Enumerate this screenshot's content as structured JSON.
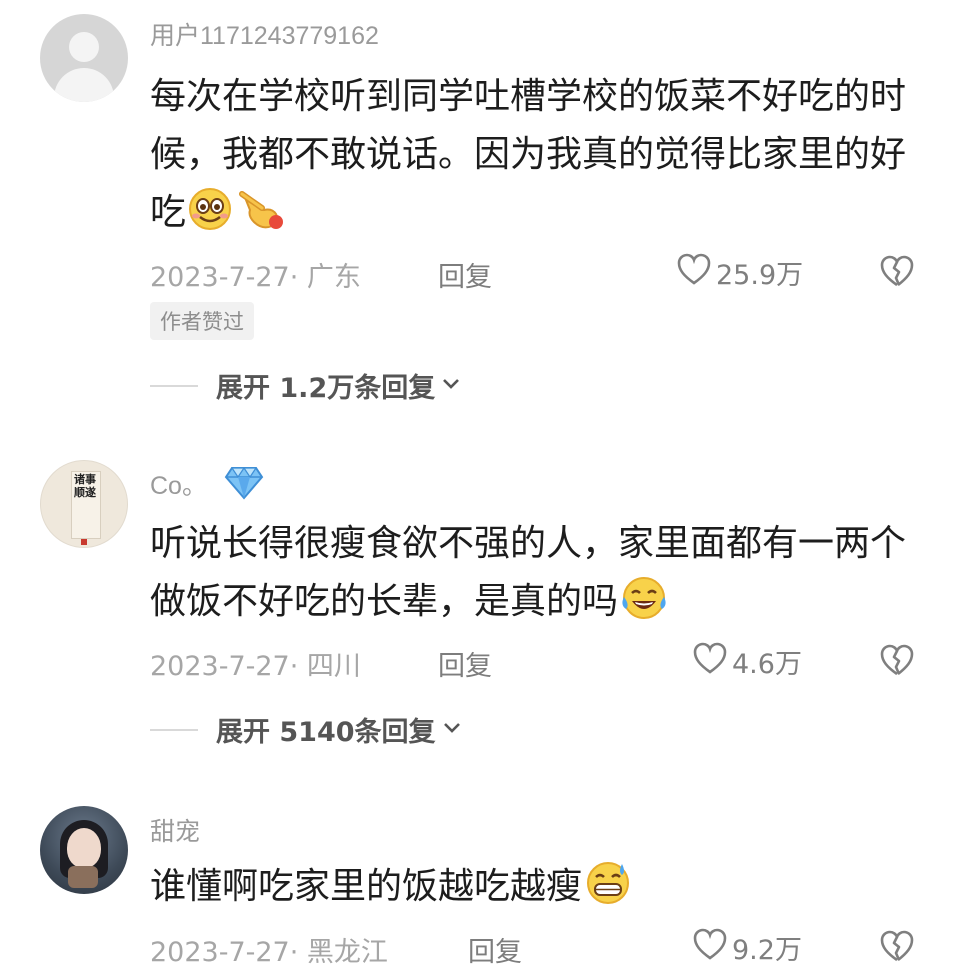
{
  "comments": [
    {
      "username": "用户1171243779162",
      "text": "每次在学校听到同学吐槽学校的饭菜不好吃的时候，我都不敢说话。因为我真的觉得比家里的好吃",
      "emojis": [
        "smile-emoji",
        "pointing-hand-emoji"
      ],
      "date": "2023-7-27",
      "location": "广东",
      "reply_label": "回复",
      "likes": "25.9万",
      "author_tag": "作者赞过",
      "expand_label": "展开 1.2万条回复"
    },
    {
      "username": "Co。",
      "badge": "diamond-icon",
      "avatar_text": "诸事顺遂",
      "text": "听说长得很瘦食欲不强的人，家里面都有一两个做饭不好吃的长辈，是真的吗",
      "emojis": [
        "laugh-cry-emoji"
      ],
      "date": "2023-7-27",
      "location": "四川",
      "reply_label": "回复",
      "likes": "4.6万",
      "expand_label": "展开 5140条回复"
    },
    {
      "username": "甜宠",
      "text": "谁懂啊吃家里的饭越吃越瘦",
      "emojis": [
        "grin-sweat-emoji"
      ],
      "date": "2023-7-27",
      "location": "黑龙江",
      "reply_label": "回复",
      "likes": "9.2万"
    }
  ],
  "colors": {
    "meta_gray": "#a6a6a6",
    "text_dark": "#1d1d1d",
    "diamond_blue": "#5aa9ec"
  }
}
